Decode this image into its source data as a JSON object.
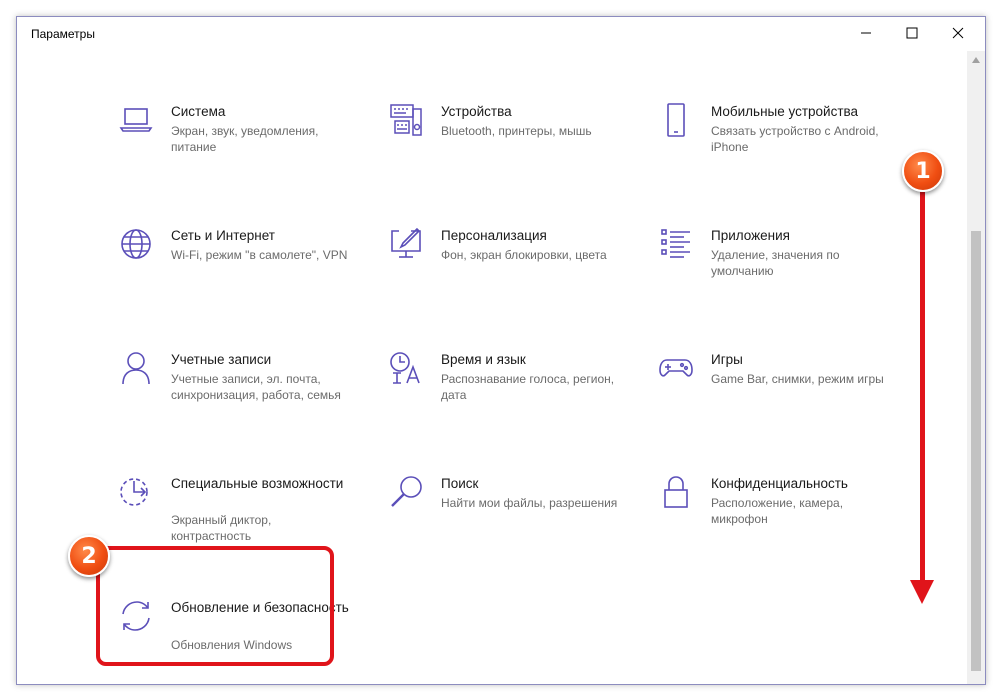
{
  "window": {
    "title": "Параметры",
    "controls": {
      "minimize": "minimize-icon",
      "maximize": "maximize-icon",
      "close": "close-icon"
    }
  },
  "tiles": [
    {
      "name": "Система",
      "desc": "Экран, звук, уведомления, питание",
      "icon": "laptop-icon"
    },
    {
      "name": "Устройства",
      "desc": "Bluetooth, принтеры, мышь",
      "icon": "keyboard-speaker-icon"
    },
    {
      "name": "Мобильные устройства",
      "desc": "Связать устройство с Android, iPhone",
      "icon": "phone-icon"
    },
    {
      "name": "Сеть и Интернет",
      "desc": "Wi-Fi, режим \"в самолете\", VPN",
      "icon": "globe-icon"
    },
    {
      "name": "Персонализация",
      "desc": "Фон, экран блокировки, цвета",
      "icon": "paint-monitor-icon"
    },
    {
      "name": "Приложения",
      "desc": "Удаление, значения по умолчанию",
      "icon": "apps-list-icon"
    },
    {
      "name": "Учетные записи",
      "desc": "Учетные записи, эл. почта, синхронизация, работа, семья",
      "icon": "person-icon"
    },
    {
      "name": "Время и язык",
      "desc": "Распознавание голоса, регион, дата",
      "icon": "time-language-icon"
    },
    {
      "name": "Игры",
      "desc": "Game Bar, снимки, режим игры",
      "icon": "gamepad-icon"
    },
    {
      "name": "Специальные возможности",
      "desc": "Экранный диктор, контрастность",
      "icon": "accessibility-icon"
    },
    {
      "name": "Поиск",
      "desc": "Найти мои файлы, разрешения",
      "icon": "search-icon"
    },
    {
      "name": "Конфиденциальность",
      "desc": "Расположение, камера, микрофон",
      "icon": "lock-icon"
    },
    {
      "name": "Обновление и безопасность",
      "desc": "Обновления Windows",
      "icon": "sync-icon"
    }
  ],
  "annotations": {
    "badge1": "1",
    "badge2": "2",
    "accent_color": "#e0141a",
    "badge_color": "#f04e12"
  },
  "colors": {
    "icon": "#5b4fb9",
    "border": "#8c8cbf"
  }
}
